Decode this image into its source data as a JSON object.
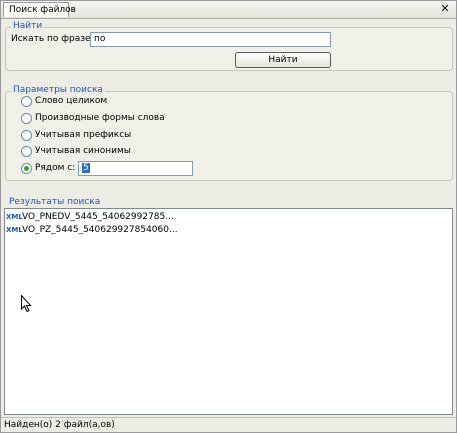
{
  "tab": {
    "title": "Поиск файлов"
  },
  "find_group": {
    "legend": "Найти",
    "phrase_label": "Искать по фразе:",
    "phrase_value": "по",
    "find_button": "Найти"
  },
  "params_group": {
    "legend": "Параметры поиска",
    "options": [
      {
        "label": "Слово целиком",
        "checked": false
      },
      {
        "label": "Производные формы слова",
        "checked": false
      },
      {
        "label": "Учитывая префиксы",
        "checked": false
      },
      {
        "label": "Учитывая синонимы",
        "checked": false
      },
      {
        "label": "Рядом с:",
        "checked": true
      }
    ],
    "near_value": "5"
  },
  "results": {
    "legend": "Результаты поиска",
    "items": [
      {
        "icon": "XML",
        "name": "VO_PNEDV_5445_54062992785..."
      },
      {
        "icon": "XML",
        "name": "VO_PZ_5445_540629927854060..."
      }
    ]
  },
  "status": {
    "text": "Найден(о) 2 файл(а,ов)"
  },
  "colors": {
    "accent": "#1f55c8",
    "radio_checked": "#33a030"
  }
}
